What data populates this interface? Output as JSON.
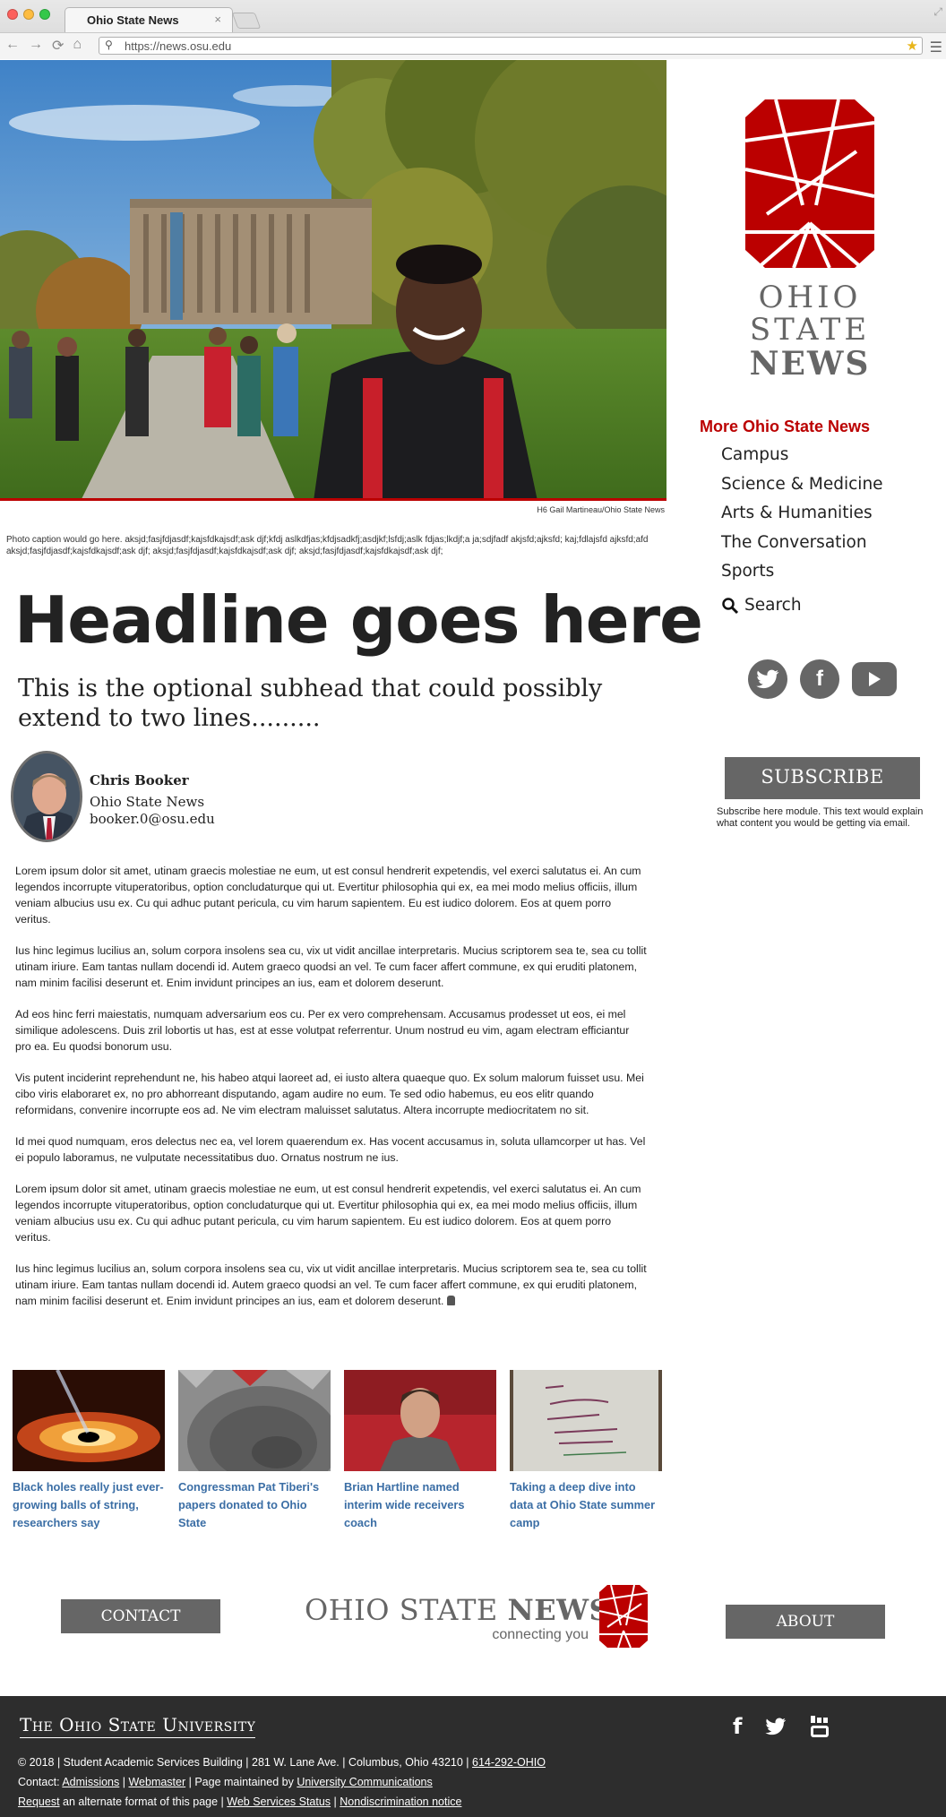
{
  "browser": {
    "tab_title": "Ohio State News",
    "tab_close": "×",
    "url": "https://news.osu.edu"
  },
  "hero": {
    "photo_credit": "H6 Gail Martineau/Ohio State News",
    "caption": "Photo caption would go here. aksjd;fasjfdjasdf;kajsfdkajsdf;ask djf;kfdj aslkdfjas;kfdjsadkfj;asdjkf;lsfdj;aslk fdjas;lkdjf;a ja;sdjfadf akjsfd;ajksfd; kaj;fdlajsfd ajksfd;afd aksjd;fasjfdjasdf;kajsfdkajsdf;ask djf; aksjd;fasjfdjasdf;kajsfdkajsdf;ask djf; aksjd;fasjfdjasdf;kajsfdkajsdf;ask djf;"
  },
  "article": {
    "headline": "Headline goes here",
    "subhead": "This is the optional subhead that could possibly extend to two lines.........",
    "author": {
      "name": "Chris Booker",
      "org": "Ohio State News",
      "email": "booker.0@osu.edu"
    },
    "paragraphs": [
      "Lorem ipsum dolor sit amet, utinam graecis molestiae ne eum, ut est consul hendrerit expetendis, vel exerci salutatus ei. An cum legendos incorrupte vituperatoribus, option concludaturque qui ut. Evertitur philosophia qui ex, ea mei modo melius officiis, illum veniam albucius usu ex. Cu qui adhuc putant pericula, cu vim harum sapientem. Eu est iudico dolorem. Eos at quem porro veritus.",
      "Ius hinc legimus lucilius an, solum corpora insolens sea cu, vix ut vidit ancillae interpretaris. Mucius scriptorem sea te, sea cu tollit utinam iriure. Eam tantas nullam docendi id. Autem graeco quodsi an vel. Te cum facer affert commune, ex qui eruditi platonem, nam minim facilisi deserunt et. Enim invidunt principes an ius, eam et dolorem deserunt.",
      "Ad eos hinc ferri maiestatis, numquam adversarium eos cu. Per ex vero comprehensam. Accusamus prodesset ut eos, ei mel similique adolescens. Duis zril lobortis ut has, est at esse volutpat referrentur. Unum nostrud eu vim, agam electram efficiantur pro ea. Eu quodsi bonorum usu.",
      "Vis putent inciderint reprehendunt ne, his habeo atqui laoreet ad, ei iusto altera quaeque quo. Ex solum malorum fuisset usu. Mei cibo viris elaboraret ex, no pro abhorreant disputando, agam audire no eum. Te sed odio habemus, eu eos elitr quando reformidans, convenire incorrupte eos ad. Ne vim electram maluisset salutatus. Altera incorrupte mediocritatem no sit.",
      "Id mei quod numquam, eros delectus nec ea, vel lorem quaerendum ex. Has vocent accusamus in, soluta ullamcorper ut has. Vel ei populo laboramus, ne vulputate necessitatibus duo. Ornatus nostrum ne ius.",
      "Lorem ipsum dolor sit amet, utinam graecis molestiae ne eum, ut est consul hendrerit expetendis, vel exerci salutatus ei. An cum legendos incorrupte vituperatoribus, option concludaturque qui ut. Evertitur philosophia qui ex, ea mei modo melius officiis, illum veniam albucius usu ex. Cu qui adhuc putant pericula, cu vim harum sapientem. Eu est iudico dolorem. Eos at quem porro veritus.",
      "Ius hinc legimus lucilius an, solum corpora insolens sea cu, vix ut vidit ancillae interpretaris. Mucius scriptorem sea te, sea cu tollit utinam iriure. Eam tantas nullam docendi id. Autem graeco quodsi an vel. Te cum facer affert commune, ex qui eruditi platonem, nam minim facilisi deserunt et. Enim invidunt principes an ius, eam et dolorem deserunt."
    ]
  },
  "related": [
    {
      "title": "Black holes really just ever-growing balls of string, researchers say"
    },
    {
      "title": "Congressman Pat Tiberi's papers donated to Ohio State"
    },
    {
      "title": "Brian Hartline named interim wide receivers coach"
    },
    {
      "title": "Taking a deep dive into data at Ohio State summer camp"
    }
  ],
  "sidebar": {
    "logo_lines": [
      "OHIO",
      "STATE",
      "NEWS"
    ],
    "more_title": "More Ohio State News",
    "nav": [
      "Campus",
      "Science & Medicine",
      "Arts & Humanities",
      "The Conversation",
      "Sports"
    ],
    "search_label": "Search",
    "subscribe_label": "SUBSCRIBE",
    "subscribe_text": "Subscribe here module. This text would explain what content you would be getting via email."
  },
  "footer": {
    "contact_label": "CONTACT",
    "about_label": "ABOUT",
    "logo_light": "OHIO STATE ",
    "logo_bold": "NEWS",
    "tagline": "connecting you",
    "university": "The Ohio State University",
    "line1_text": "© 2018 | Student Academic Services Building | 281 W. Lane Ave. | Columbus, Ohio 43210 | ",
    "line1_phone": "614-292-OHIO",
    "line2_prefix": "Contact: ",
    "line2_admissions": "Admissions",
    "line2_sep1": " | ",
    "line2_webmaster": "Webmaster",
    "line2_mid": " | Page maintained by ",
    "line2_comm": "University Communications",
    "line3_request": "Request",
    "line3_mid": " an alternate format of this page | ",
    "line3_status": "Web Services Status",
    "line3_sep": " | ",
    "line3_nondisc": "Nondiscrimination notice"
  },
  "colors": {
    "scarlet": "#bb0000",
    "gray": "#666666",
    "link_blue": "#3b6ea5",
    "footer_bg": "#2d2d2d"
  }
}
